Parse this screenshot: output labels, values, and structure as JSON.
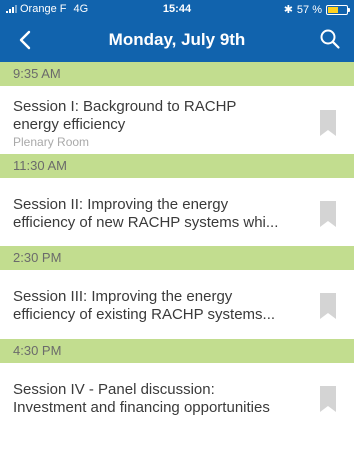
{
  "status_bar": {
    "carrier": "Orange F",
    "network": "4G",
    "time": "15:44",
    "battery": "57 %",
    "battery_level": 0.57,
    "bluetooth_icon": "bluetooth-icon"
  },
  "nav": {
    "title": "Monday, July 9th",
    "back_icon": "chevron-left-icon",
    "search_icon": "search-icon"
  },
  "colors": {
    "header_bg": "#1163ad",
    "time_header_bg": "#c2dd8f",
    "bookmark": "#d4d4d4"
  },
  "schedule": [
    {
      "time": "9:35 AM",
      "title_lines": [
        "Session I: Background to RACHP",
        "energy efficiency"
      ],
      "room": "Plenary Room"
    },
    {
      "time": "11:30 AM",
      "title_lines": [
        "Session II: Improving the energy",
        "efficiency of new RACHP systems whi..."
      ],
      "room": ""
    },
    {
      "time": "2:30 PM",
      "title_lines": [
        "Session III: Improving the energy",
        "efficiency of existing RACHP systems..."
      ],
      "room": ""
    },
    {
      "time": "4:30 PM",
      "title_lines": [
        "Session IV - Panel discussion:",
        "Investment and financing opportunities"
      ],
      "room": ""
    }
  ]
}
